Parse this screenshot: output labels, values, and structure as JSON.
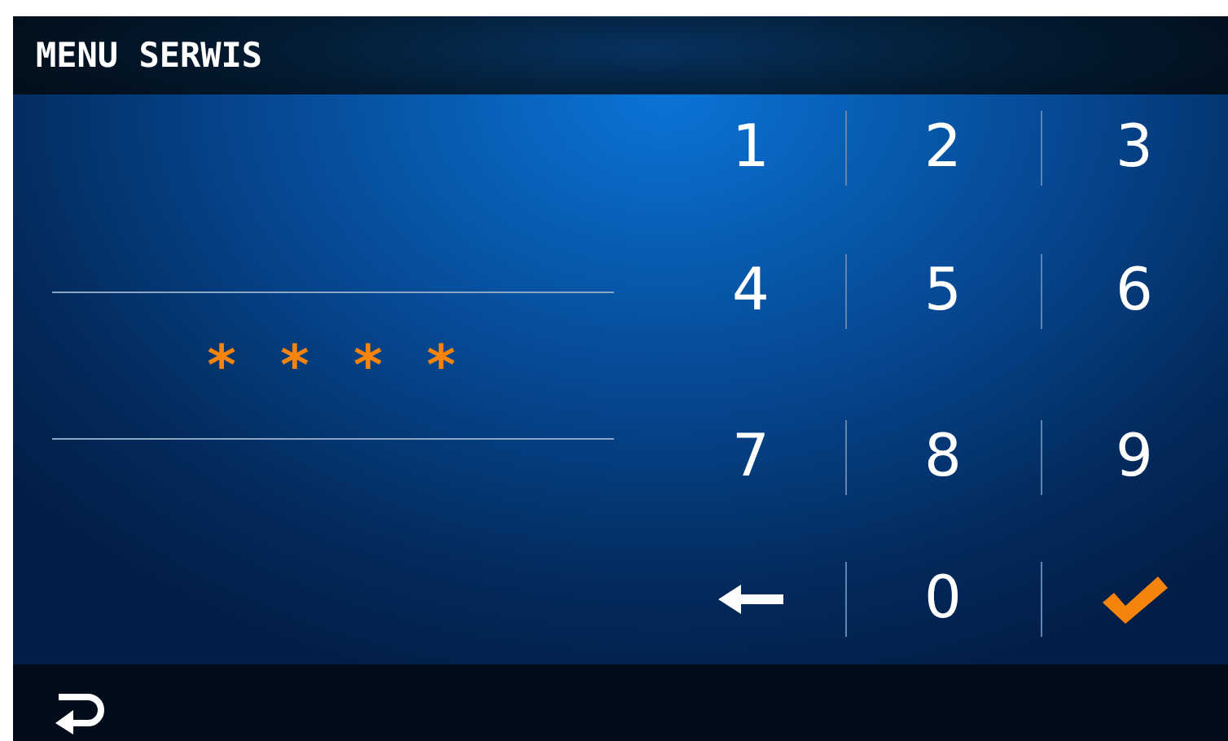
{
  "header": {
    "title": "MENU SERWIS"
  },
  "password": {
    "masked": "* * * *"
  },
  "keypad": [
    {
      "kind": "digit",
      "label": "1"
    },
    {
      "kind": "digit",
      "label": "2"
    },
    {
      "kind": "digit",
      "label": "3"
    },
    {
      "kind": "digit",
      "label": "4"
    },
    {
      "kind": "digit",
      "label": "5"
    },
    {
      "kind": "digit",
      "label": "6"
    },
    {
      "kind": "digit",
      "label": "7"
    },
    {
      "kind": "digit",
      "label": "8"
    },
    {
      "kind": "digit",
      "label": "9"
    },
    {
      "kind": "backspace"
    },
    {
      "kind": "digit",
      "label": "0"
    },
    {
      "kind": "confirm"
    }
  ],
  "footer": {
    "back": true
  }
}
